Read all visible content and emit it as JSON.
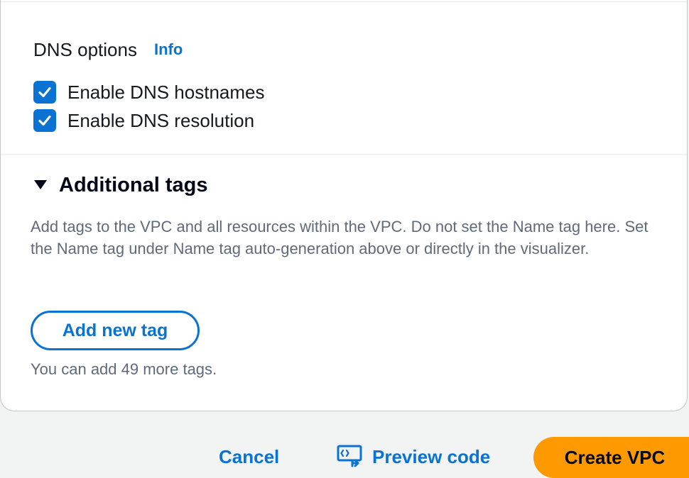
{
  "dns": {
    "title": "DNS options",
    "info_link": "Info",
    "options": [
      {
        "label": "Enable DNS hostnames",
        "checked": true
      },
      {
        "label": "Enable DNS resolution",
        "checked": true
      }
    ]
  },
  "tags": {
    "title": "Additional tags",
    "expanded": true,
    "description": "Add tags to the VPC and all resources within the VPC. Do not set the Name tag here. Set the Name tag under Name tag auto-generation above or directly in the visualizer.",
    "add_button": "Add new tag",
    "hint": "You can add 49 more tags."
  },
  "footer": {
    "cancel": "Cancel",
    "preview": "Preview code",
    "create": "Create VPC"
  },
  "icons": {
    "checkbox": "check-icon",
    "caret": "caret-down-icon",
    "preview": "code-preview-icon"
  },
  "colors": {
    "link_blue": "#0972d3",
    "primary_orange": "#ff9900",
    "muted_text": "#5f6b7a"
  }
}
